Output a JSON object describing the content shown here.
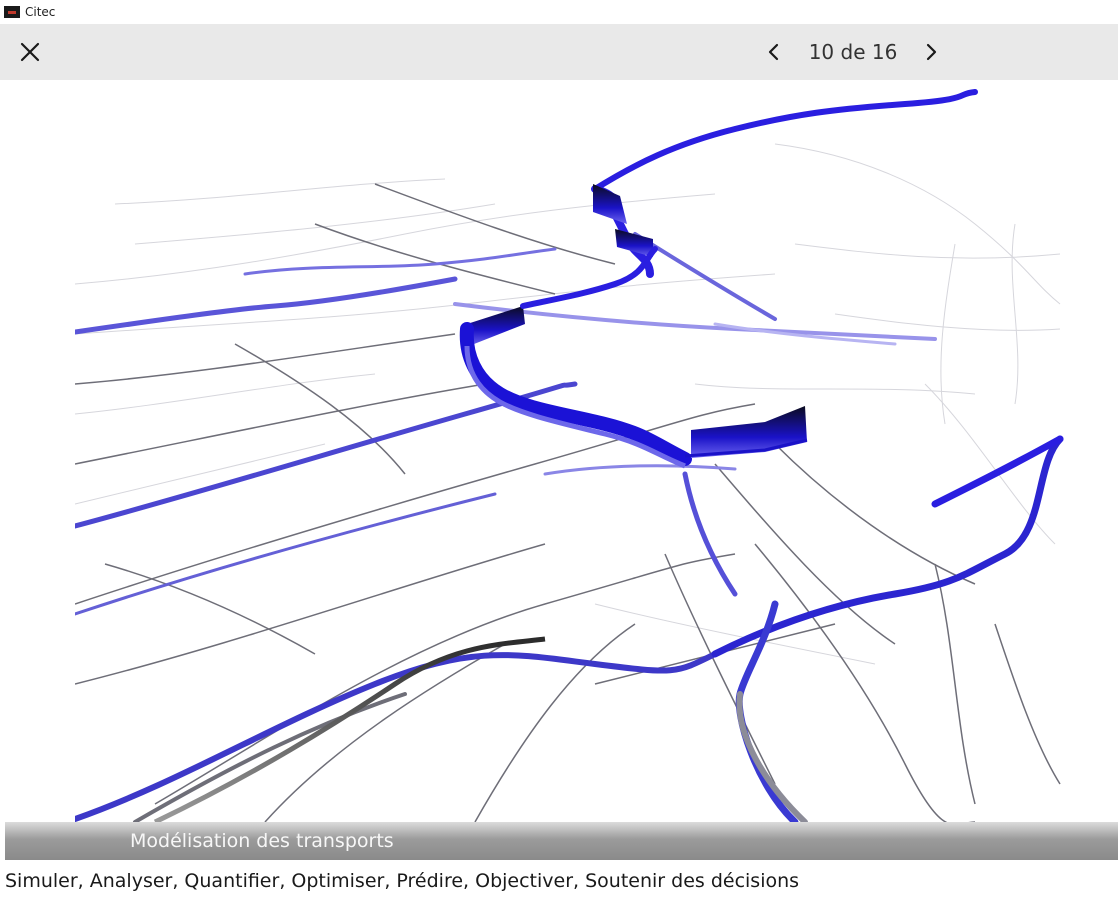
{
  "window": {
    "title": "Citec",
    "icon": "citec-app-icon"
  },
  "viewer": {
    "close_icon": "close-icon",
    "prev_icon": "chevron-left-icon",
    "next_icon": "chevron-right-icon",
    "counter": "10 de 16",
    "toolbar_color": "#e9e9e9"
  },
  "slide": {
    "image": "transport-flow-map",
    "caption_title": "Modélisation des transports",
    "caption_text": "Simuler, Analyser, Quantifier, Optimiser, Prédire, Objectiver, Soutenir des décisions",
    "accent_color": "#2a1ee0"
  }
}
